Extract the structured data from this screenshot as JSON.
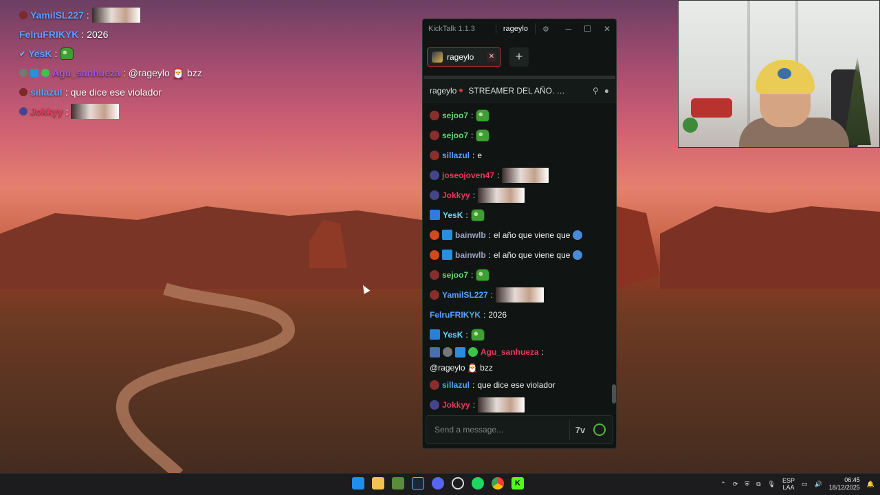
{
  "overlay": {
    "messages": [
      {
        "user": "YamilSL227",
        "color": "#5aa2ff",
        "text": "",
        "emote": "image"
      },
      {
        "user": "FelruFRIKYK",
        "color": "#5aa2ff",
        "text": "2026"
      },
      {
        "user": "YesK",
        "color": "#5aa2ff",
        "text": "",
        "emote": "pepe"
      },
      {
        "user": "Agu_sanhueza",
        "color": "#a056e0",
        "text": "@rageylo 🎅 bzz"
      },
      {
        "user": "sillazul",
        "color": "#5aa2ff",
        "text": "que dice ese violador"
      },
      {
        "user": "Jokkyy",
        "color": "#e23d5a",
        "text": "",
        "emote": "image"
      }
    ]
  },
  "window": {
    "app_title": "KickTalk 1.1.3",
    "account": "rageylo",
    "controls": {
      "settings": "⚙",
      "minimize": "─",
      "maximize": "☐",
      "close": "✕"
    }
  },
  "tabs": [
    {
      "label": "rageylo",
      "close": "✕"
    }
  ],
  "add_tab_label": "+",
  "channel": {
    "name": "rageylo",
    "title": "STREAMER DEL AÑO. G..."
  },
  "chat": [
    {
      "user": "sejoo7",
      "color": "#67d47a",
      "text": "",
      "emote": "pepe"
    },
    {
      "user": "sejoo7",
      "color": "#67d47a",
      "text": "",
      "emote": "pepe"
    },
    {
      "user": "sillazul",
      "color": "#5aa2ff",
      "text": "e"
    },
    {
      "user": "joseojoven47",
      "color": "#e23d5a",
      "text": "",
      "emote": "image"
    },
    {
      "user": "Jokkyy",
      "color": "#e23d5a",
      "text": "",
      "emote": "image"
    },
    {
      "user": "YesK",
      "color": "#6cd6ff",
      "text": "",
      "emote": "pepe"
    },
    {
      "user": "bainwlb",
      "color": "#9aa2c0",
      "text": "el año que viene que"
    },
    {
      "user": "bainwlb",
      "color": "#9aa2c0",
      "text": "el año que viene que"
    },
    {
      "user": "sejoo7",
      "color": "#67d47a",
      "text": "",
      "emote": "pepe"
    },
    {
      "user": "YamilSL227",
      "color": "#5aa2ff",
      "text": "",
      "emote": "image"
    },
    {
      "user": "FelruFRIKYK",
      "color": "#5aa2ff",
      "text": "2026"
    },
    {
      "user": "YesK",
      "color": "#6cd6ff",
      "text": "",
      "emote": "pepe"
    },
    {
      "user": "Agu_sanhueza",
      "color": "#e23d5a",
      "text": "@rageylo 🎅 bzz"
    },
    {
      "user": "sillazul",
      "color": "#5aa2ff",
      "text": "que dice ese violador"
    },
    {
      "user": "Jokkyy",
      "color": "#e23d5a",
      "text": "",
      "emote": "image"
    }
  ],
  "input": {
    "placeholder": "Send a message..."
  },
  "taskbar": {
    "lang_top": "ESP",
    "lang_bottom": "LAA",
    "time": "06:45",
    "date": "18/12/2025",
    "apps": [
      "windows-start",
      "file-explorer",
      "xbox-game-bar",
      "steam",
      "discord",
      "clock-app",
      "spotify",
      "chrome",
      "kicktalk"
    ]
  },
  "colors": {
    "kick_green": "#53fc18",
    "accent_red": "#b22c32",
    "chat_bg": "#101513"
  }
}
